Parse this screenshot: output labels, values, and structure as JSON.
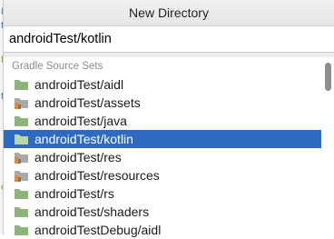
{
  "dialog": {
    "title": "New Directory"
  },
  "input": {
    "value": "androidTest/kotlin"
  },
  "list": {
    "section": "Gradle Source Sets",
    "items": [
      {
        "label": "androidTest/aidl",
        "icon": "plain-folder-icon"
      },
      {
        "label": "androidTest/assets",
        "icon": "resource-folder-icon"
      },
      {
        "label": "androidTest/java",
        "icon": "plain-folder-icon"
      },
      {
        "label": "androidTest/kotlin",
        "icon": "plain-folder-icon",
        "selected": true
      },
      {
        "label": "androidTest/res",
        "icon": "resource-folder-icon"
      },
      {
        "label": "androidTest/resources",
        "icon": "resource-folder-icon"
      },
      {
        "label": "androidTest/rs",
        "icon": "plain-folder-icon"
      },
      {
        "label": "androidTest/shaders",
        "icon": "plain-folder-icon"
      },
      {
        "label": "androidTestDebug/aidl",
        "icon": "plain-folder-icon"
      }
    ]
  },
  "colors": {
    "selection": "#2c6bc1",
    "folder": "#8db47a",
    "resource_accent": "#e38a2c"
  }
}
